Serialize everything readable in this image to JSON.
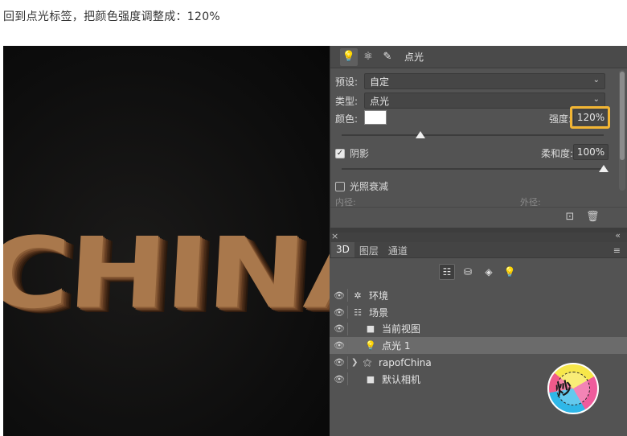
{
  "caption": "回到点光标签，把颜色强度调整成：120%",
  "canvas": {
    "text": "CHINA"
  },
  "properties": {
    "tab_title": "点光",
    "preset_label": "预设:",
    "preset_value": "自定",
    "type_label": "类型:",
    "type_value": "点光",
    "color_label": "颜色:",
    "intensity_label": "强度:",
    "intensity_value": "120%",
    "shadow_label": "阴影",
    "softness_label": "柔和度:",
    "softness_value": "100%",
    "falloff_label": "光照衰减",
    "inner_label": "内径:",
    "outer_label": "外径:",
    "intensity_slider_level": 0.3,
    "softness_slider_level": 1.0
  },
  "panel3d": {
    "tabs": [
      "3D",
      "图层",
      "通道"
    ],
    "layers": [
      {
        "name": "环境",
        "icon": "environment-icon",
        "indent": 0
      },
      {
        "name": "场景",
        "icon": "scene-icon",
        "indent": 0
      },
      {
        "name": "当前视图",
        "icon": "camera-icon",
        "indent": 1
      },
      {
        "name": "点光 1",
        "icon": "light-bulb-icon",
        "indent": 1,
        "selected": true
      },
      {
        "name": "rapofChina",
        "icon": "mesh-icon",
        "indent": 1,
        "expandable": true
      },
      {
        "name": "默认相机",
        "icon": "camera-icon",
        "indent": 1
      }
    ]
  },
  "colors": {
    "highlight": "#f2b533",
    "panel": "#535353",
    "selected_row": "#6b6b6b"
  }
}
